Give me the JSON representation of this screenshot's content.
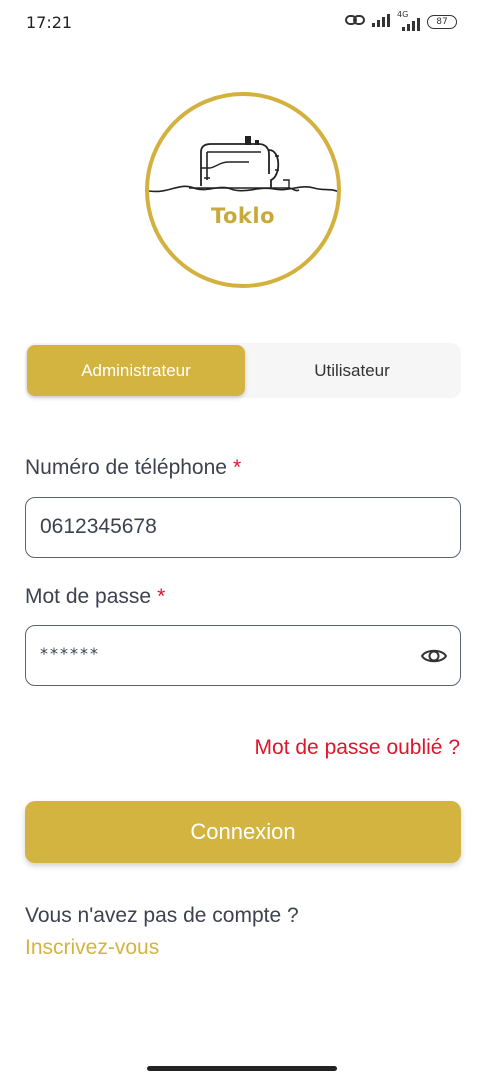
{
  "status_bar": {
    "time": "17:21",
    "network_label": "4G",
    "battery": "87"
  },
  "logo": {
    "text": "Toklo",
    "icon": "sewing-machine-icon",
    "color": "#d4b13f"
  },
  "role_tabs": {
    "admin_label": "Administrateur",
    "user_label": "Utilisateur",
    "selected": "Administrateur"
  },
  "form": {
    "phone_label": "Numéro de téléphone",
    "phone_value": "0612345678",
    "password_label": "Mot de passe",
    "password_value": "******",
    "required_mark": "*",
    "forgot_password": "Mot de passe oublié ?",
    "submit_label": "Connexion"
  },
  "signup": {
    "prompt": "Vous n'avez pas de compte ?",
    "link": "Inscrivez-vous"
  },
  "colors": {
    "accent": "#d4b440",
    "error": "#e0142b",
    "text": "#3e4250"
  }
}
